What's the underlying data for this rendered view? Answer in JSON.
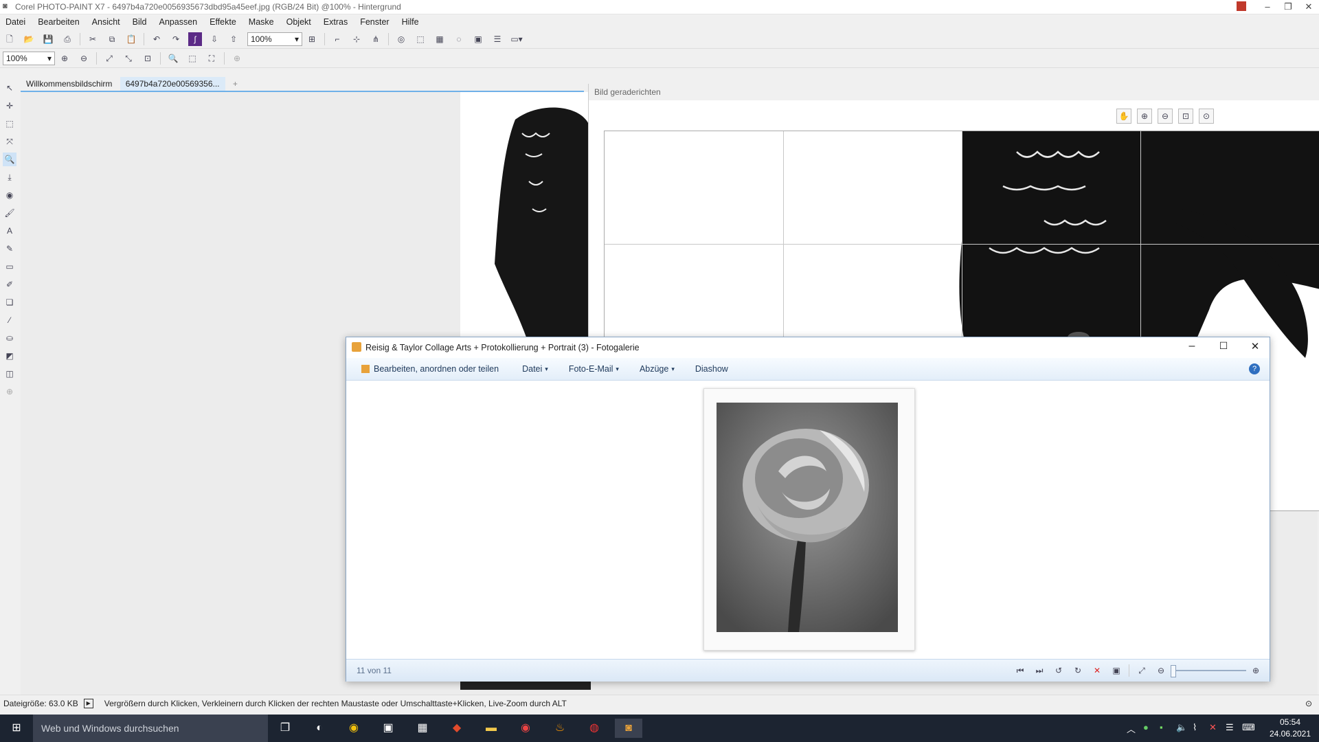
{
  "corel": {
    "title": "Corel PHOTO-PAINT X7 - 6497b4a720e0056935673dbd95a45eef.jpg (RGB/24 Bit) @100% - Hintergrund",
    "menu": [
      "Datei",
      "Bearbeiten",
      "Ansicht",
      "Bild",
      "Anpassen",
      "Effekte",
      "Maske",
      "Objekt",
      "Extras",
      "Fenster",
      "Hilfe"
    ],
    "zoom_main": "100%",
    "zoom_secondary": "100%",
    "tabs": [
      "Willkommensbildschirm",
      "6497b4a720e00569356..."
    ],
    "tab_add": "+",
    "straighten_title": "Bild geraderichten",
    "status_filesize": "Dateigröße: 63.0 KB",
    "status_hint": "Vergrößern durch Klicken, Verkleinern durch Klicken der rechten Maustaste oder Umschalttaste+Klicken, Live-Zoom durch ALT"
  },
  "gallery": {
    "title": "Reisig & Taylor Collage Arts + Protokollierung + Portrait  (3) - Fotogalerie",
    "menu": {
      "edit": "Bearbeiten, anordnen oder teilen",
      "file": "Datei",
      "email": "Foto-E-Mail",
      "prints": "Abzüge",
      "slideshow": "Diashow"
    },
    "counter": "11 von 11"
  },
  "taskbar": {
    "search_placeholder": "Web und Windows durchsuchen",
    "time": "05:54",
    "date": "24.06.2021"
  },
  "colors": {
    "accent": "#3b82c4",
    "taskbar": "#1c2431"
  }
}
